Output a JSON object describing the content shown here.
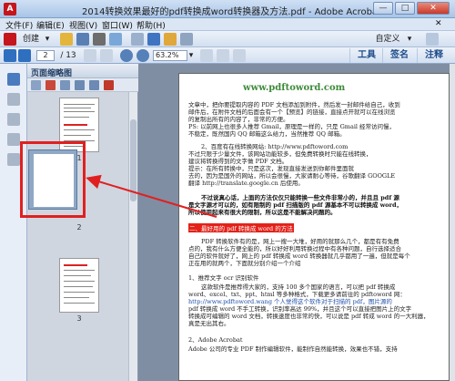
{
  "window": {
    "title": "2014转换效果最好的pdf转换成word转换器及方法.pdf - Adobe Acrobat Pro",
    "min": "—",
    "max": "□",
    "close": "✕"
  },
  "menu": [
    "文件(F)",
    "编辑(E)",
    "视图(V)",
    "窗口(W)",
    "帮助(H)"
  ],
  "toolbar": {
    "create": "创建",
    "customize": "自定义",
    "page_current": "2",
    "page_total": "/ 13",
    "zoom": "63.2%"
  },
  "right_tabs": [
    "工具",
    "签名",
    "注释"
  ],
  "thumb_panel": {
    "title": "页面缩略图",
    "page_numbers": [
      "1",
      "2",
      "3"
    ]
  },
  "doc": {
    "watermark": "www.pdftoword.com",
    "lines": [
      "文章中，把你要提取内容的 PDF 文档添加到附件，然后发一封邮件给自己，收到",
      "邮件后，在附件文档的后面会有一个【预览】的链接，直接点开就可以在线浏览",
      "的复制出所有的内容了，非常的方便。",
      "PS: 以前网上也很多人推荐 Gmail，原理是一样的，只是 Gmail 经常访问慢，",
      "不稳定，既然国内 QQ 邮箱这么给力，当然推荐 QQ 邮箱。",
      "2、百度有在线转换网站: http://www.pdftoword.com",
      "不过只限于少量文件，该网站功能较多，但免费转换时只能在线转换，",
      "建议将转换得到的文字做 PDF 文档。",
      "提示：在所有转换中，只是这次，发现直接发送到你邮件里面就",
      "去的，因为是国外的网站，所以会很慢，大家请耐心等待，谷歌翻译 GOOGLE",
      "翻译 http://translate.google.cn 后使用。",
      "不过说真心话，上面的方法仅仅只能转换一些文件非常小的，并且且 pdf 源",
      "是文字源才可以的，如有限制的 pdf 扫描版的 pdf 源基本不可以转换成 word，",
      "所以使用起来有很大的限制，所以这是不能解决问题的。",
      "二、最好用的 pdf 转换成 word 的方法",
      "PDF 转换软件有的是，网上一搜一大堆，好用的就那么几个，都是有有免费",
      "点的，我有什么方便全能的，所以好好利用转换过程中有各种问题，自行选择适合",
      "自己的软件就好了，网上的 pdf 转换成 word 转换器就几乎都用了一遍，但就是每个",
      "正在用的就两个，下面就分别介绍一个介绍",
      "1、推荐文字 ocr 识别软件",
      "这款软件是推荐得大家的，支持 100 多个国家的语言，可以把 pdf 转换成",
      "word、excel、txt、ppt、html 等多种格式，下载更多请前往的 pdftoword 网：",
      "http://www.pdftoword.wang 个人觉得这个软件对于扫描的 pdf，图片源的",
      "pdf 转换成 word 不手工转换，识别率高达 99%，并且这个可以直接把图片上的文字",
      "转换成可编辑的 word 文档，转换速度也非常的快，可以说是 pdf 转成 word 的一大利器，",
      "真是无出其右。",
      "2、Adobe Acrobat",
      "Adobe 公司的专业 PDF 制作编辑软件，能制作自然能转换，效果也不错，支持"
    ]
  },
  "colors": {
    "highlight_red": "#e02020",
    "watermark_green": "#3e8a3a",
    "window_blue": "#a9c5e8"
  }
}
